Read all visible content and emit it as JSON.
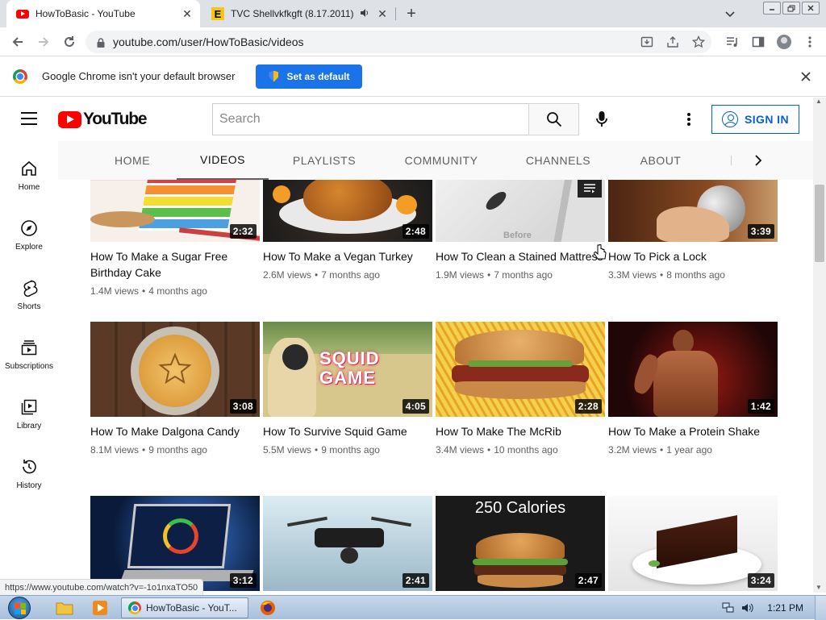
{
  "browser": {
    "tabs": [
      {
        "title": "HowToBasic - YouTube",
        "active": true
      },
      {
        "title": "TVC Shellvkfkgft (8.17.2011)",
        "active": false,
        "favicon_letter": "E"
      }
    ],
    "new_tab": "+",
    "close_glyph": "✕",
    "url": "youtube.com/user/HowToBasic/videos",
    "infobar": {
      "message": "Google Chrome isn't your default browser",
      "button": "Set as default"
    },
    "status_url": "https://www.youtube.com/watch?v=-1o1nxaTO50"
  },
  "youtube": {
    "logo_text": "YouTube",
    "search_placeholder": "Search",
    "signin_label": "SIGN IN",
    "guide": [
      {
        "label": "Home",
        "icon": "home-icon"
      },
      {
        "label": "Explore",
        "icon": "compass-icon"
      },
      {
        "label": "Shorts",
        "icon": "shorts-icon"
      },
      {
        "label": "Subscriptions",
        "icon": "subscriptions-icon"
      },
      {
        "label": "Library",
        "icon": "library-icon"
      },
      {
        "label": "History",
        "icon": "history-icon"
      }
    ],
    "channel_tabs": [
      {
        "label": "HOME"
      },
      {
        "label": "VIDEOS",
        "selected": true
      },
      {
        "label": "PLAYLISTS"
      },
      {
        "label": "COMMUNITY"
      },
      {
        "label": "CHANNELS"
      },
      {
        "label": "ABOUT"
      }
    ],
    "videos": [
      {
        "title": "How To Make a Sugar Free Birthday Cake",
        "duration": "2:32",
        "views": "1.4M views",
        "age": "4 months ago"
      },
      {
        "title": "How To Make a Vegan Turkey",
        "duration": "2:48",
        "views": "2.6M views",
        "age": "7 months ago"
      },
      {
        "title": "How To Clean a Stained Mattress",
        "duration": "",
        "views": "1.9M views",
        "age": "7 months ago",
        "thumb_text": "Before"
      },
      {
        "title": "How To Pick a Lock",
        "duration": "3:39",
        "views": "3.3M views",
        "age": "8 months ago"
      },
      {
        "title": "How To Make Dalgona Candy",
        "duration": "3:08",
        "views": "8.1M views",
        "age": "9 months ago"
      },
      {
        "title": "How To Survive Squid Game",
        "duration": "4:05",
        "views": "5.5M views",
        "age": "9 months ago",
        "thumb_text": "SQUID GAME"
      },
      {
        "title": "How To Make The McRib",
        "duration": "2:28",
        "views": "3.4M views",
        "age": "10 months ago"
      },
      {
        "title": "How To Make a Protein Shake",
        "duration": "1:42",
        "views": "3.2M views",
        "age": "1 year ago"
      },
      {
        "title": "",
        "duration": "3:12",
        "views": "",
        "age": ""
      },
      {
        "title": "",
        "duration": "2:41",
        "views": "",
        "age": ""
      },
      {
        "title": "",
        "duration": "2:47",
        "views": "",
        "age": "",
        "thumb_text": "250 Calories"
      },
      {
        "title": "",
        "duration": "3:24",
        "views": "",
        "age": ""
      }
    ]
  },
  "taskbar": {
    "chrome_task": "HowToBasic - YouT...",
    "clock": "1:21 PM"
  },
  "colors": {
    "youtube_red": "#ff0000",
    "signin_blue": "#065fd4",
    "chrome_blue": "#1a73e8"
  }
}
